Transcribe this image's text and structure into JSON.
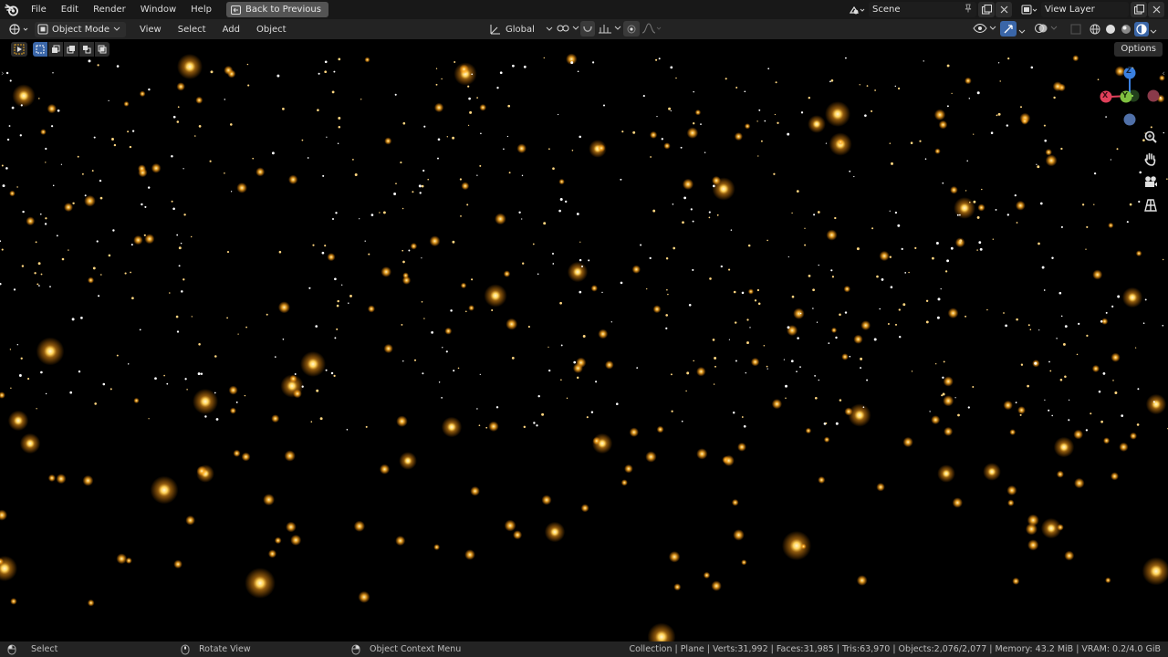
{
  "topbar": {
    "menus": [
      "File",
      "Edit",
      "Render",
      "Window",
      "Help"
    ],
    "back_button": "Back to Previous",
    "scene_name": "Scene",
    "view_layer_name": "View Layer"
  },
  "viewport_header": {
    "mode": "Object Mode",
    "menus": [
      "View",
      "Select",
      "Add",
      "Object"
    ],
    "transform_orientation": "Global"
  },
  "toolrow": {
    "options_label": "Options"
  },
  "gizmo": {
    "z_label": "Z",
    "x_label": "X",
    "y_label": "Y",
    "colors": {
      "x": "#e0405a",
      "y": "#7fc040",
      "z": "#3a80e0",
      "neg": "#5070a8"
    }
  },
  "nav_icons": [
    "zoom-icon",
    "pan-hand-icon",
    "camera-icon",
    "grid-view-icon"
  ],
  "statusbar": {
    "select": "Select",
    "rotate": "Rotate View",
    "context_menu": "Object Context Menu",
    "stats": "Collection | Plane | Verts:31,992 | Faces:31,985 | Tris:63,970 | Objects:2,076/2,077 | Memory: 43.2 MiB | VRAM: 0.2/4.0 GiB"
  },
  "colors": {
    "particle_core": "#fff4c8",
    "particle_glow": "#ffa21a"
  }
}
